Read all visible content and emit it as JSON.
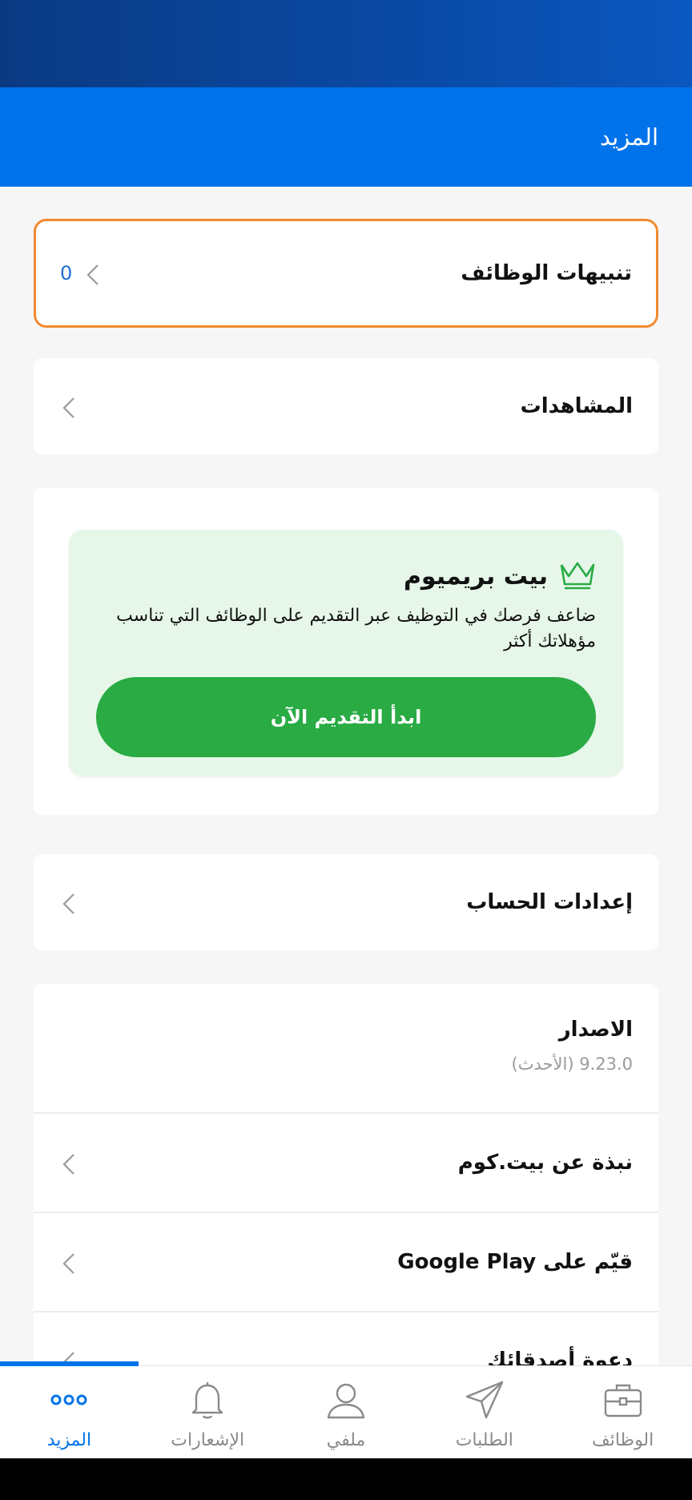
{
  "header": {
    "title": "المزيد"
  },
  "job_alerts": {
    "label": "تنبيهات الوظائف",
    "count": "0"
  },
  "views": {
    "label": "المشاهدات"
  },
  "premium": {
    "title": "بيت بريميوم",
    "description": "ضاعف فرصك في التوظيف عبر التقديم على الوظائف التي تناسب مؤهلاتك أكثر",
    "button": "ابدأ التقديم الآن",
    "icon": "crown-icon"
  },
  "account_settings": {
    "label": "إعدادات الحساب"
  },
  "version": {
    "label": "الاصدار",
    "value": "9.23.0 (الأحدث)"
  },
  "about": {
    "label": "نبذة عن بيت.كوم"
  },
  "rate": {
    "label": "قيّم على Google Play"
  },
  "invite": {
    "label": "دعوة أصدقائك"
  },
  "bottom_nav": {
    "items": [
      {
        "label": "الوظائف",
        "icon": "briefcase-icon"
      },
      {
        "label": "الطلبات",
        "icon": "paper-plane-icon"
      },
      {
        "label": "ملفي",
        "icon": "user-icon"
      },
      {
        "label": "الإشعارات",
        "icon": "bell-icon"
      },
      {
        "label": "المزيد",
        "icon": "more-dots-icon",
        "active": true
      }
    ]
  },
  "colors": {
    "primary": "#0073ea",
    "premium_bg": "#e6f7e9",
    "premium_button": "#2aab44",
    "highlight_border": "#f28a2f"
  }
}
